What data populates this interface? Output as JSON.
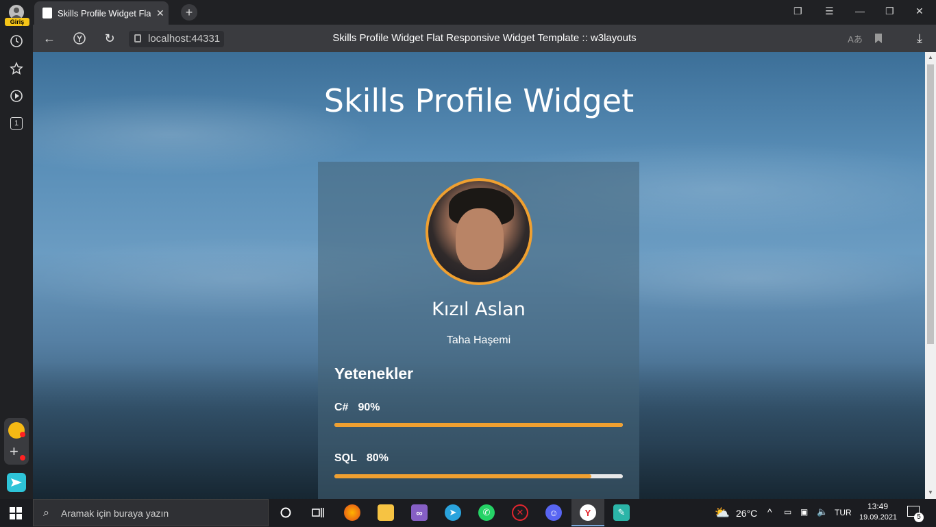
{
  "browser": {
    "profile_label": "Giriş",
    "tab_title": "Skills Profile Widget Flat",
    "url": "localhost:44331",
    "page_title": "Skills Profile Widget Flat Responsive Widget Template :: w3layouts",
    "sidebar_badge": "1"
  },
  "page": {
    "heading": "Skills Profile Widget",
    "name": "Kızıl Aslan",
    "subtitle": "Taha Haşemi",
    "skills_heading": "Yetenekler",
    "skills": [
      {
        "name": "C#",
        "percent_label": "90%",
        "level": 1.0
      },
      {
        "name": "SQL",
        "percent_label": "80%",
        "level": 0.89
      }
    ],
    "accent_color": "#f0a030"
  },
  "taskbar": {
    "search_placeholder": "Aramak için buraya yazın",
    "temperature": "26°C",
    "language": "TUR",
    "time": "13:49",
    "date": "19.09.2021",
    "notifications": "5"
  }
}
